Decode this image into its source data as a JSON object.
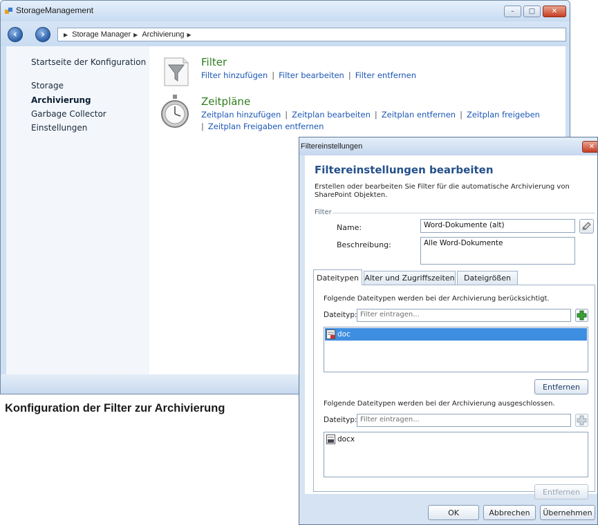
{
  "window": {
    "title": "StorageManagement",
    "controls": {
      "minimize": "–",
      "maximize": "□",
      "close": "✕"
    }
  },
  "breadcrumb": [
    "Storage Manager",
    "Archivierung"
  ],
  "sidebar": {
    "items": [
      {
        "label": "Startseite der Konfiguration",
        "active": false
      },
      {
        "label": "Storage",
        "active": false
      },
      {
        "label": "Archivierung",
        "active": true
      },
      {
        "label": "Garbage Collector",
        "active": false
      },
      {
        "label": "Einstellungen",
        "active": false
      }
    ]
  },
  "sections": {
    "filter": {
      "title": "Filter",
      "icon": "funnel-icon",
      "links": [
        "Filter hinzufügen",
        "Filter bearbeiten",
        "Filter entfernen"
      ]
    },
    "schedules": {
      "title": "Zeitpläne",
      "icon": "stopwatch-icon",
      "links": [
        "Zeitplan hinzufügen",
        "Zeitplan bearbeiten",
        "Zeitplan entfernen",
        "Zeitplan freigeben"
      ],
      "links_line2": [
        "Zeitplan Freigaben entfernen"
      ]
    }
  },
  "caption": "Konfiguration der Filter zur Archivierung",
  "dialog": {
    "title": "Filtereinstellungen",
    "close": "✕",
    "heading": "Filtereinstellungen bearbeiten",
    "description": "Erstellen oder bearbeiten Sie Filter für die automatische Archivierung von SharePoint Objekten.",
    "fieldset_label": "Filter",
    "name_label": "Name:",
    "name_value": "Word-Dokumente (alt)",
    "description_label": "Beschreibung:",
    "description_value": "Alle Word-Dokumente",
    "tabs": [
      "Dateitypen",
      "Alter und Zugriffszeiten",
      "Dateigrößen"
    ],
    "included": {
      "text": "Folgende Dateitypen werden bei der Archivierung berücksichtigt.",
      "type_label": "Dateityp:",
      "placeholder": "Filter eintragen...",
      "items": [
        "doc"
      ],
      "remove_label": "Entfernen"
    },
    "excluded": {
      "text": "Folgende Dateitypen werden bei der Archivierung ausgeschlossen.",
      "type_label": "Dateityp:",
      "placeholder": "Filter eintragen...",
      "items": [
        "docx"
      ],
      "remove_label": "Entfernen"
    },
    "buttons": {
      "ok": "OK",
      "cancel": "Abbrechen",
      "apply": "Übernehmen"
    }
  },
  "colors": {
    "accent_green": "#2e7d1e",
    "link_blue": "#1a56b5",
    "heading_blue": "#24508a",
    "selection_blue": "#3d8ee0"
  }
}
